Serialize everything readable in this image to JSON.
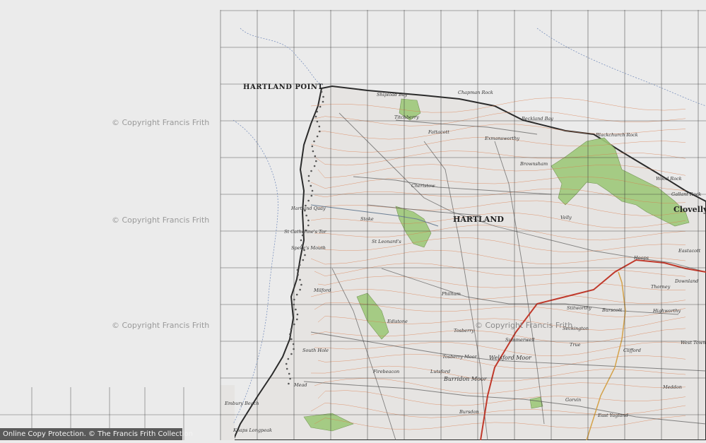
{
  "map": {
    "place_labels": {
      "hartland_point": "HARTLAND POINT",
      "hartland": "HARTLAND",
      "clovelly": "Clovelly",
      "welsford_moor": "Welsford Moor",
      "burridon_moor": "Burridon Moor",
      "embury_beach": "Embury Beach",
      "knaps_longpeak": "Knaps Longpeak",
      "chapman_rock": "Chapman Rock",
      "beckland_bay": "Beckland Bay",
      "shipload_bay": "Shipload Bay",
      "blackchurch_rock": "Blackchurch Rock",
      "wood_rock": "Wood Rock",
      "gallant_rock": "Gallant Rock",
      "hartland_quay": "Hartland Quay",
      "st_catherines_tor": "St Catherine's Tor",
      "speke_mouth": "Speke's Mouth",
      "stoke": "Stoke",
      "st_leonards": "St Leonard's",
      "edistone": "Edistone",
      "highworthy": "Highworthy",
      "thorney": "Thorney",
      "downland": "Downland",
      "eastacott": "Eastacott",
      "hoops": "Hoops",
      "true": "True",
      "milford": "Milford",
      "mead": "Mead",
      "titchberry": "Titchberry",
      "exmansworthy": "Exmansworthy",
      "brownsham": "Brownsham",
      "fattacott": "Fattacott",
      "lutsford": "Lutsford",
      "firebeacon": "Firebeacon",
      "summerwell": "Summerwell",
      "tosberry": "Tosberry",
      "tosberry_moor": "Tosberry Moor",
      "seckington": "Seckington",
      "stitworthy": "Stitworthy",
      "burscott": "Burscott",
      "clifford": "Clifford",
      "west_town": "West Town",
      "gorvin": "Gorvin",
      "east_yagland": "East Yagland",
      "philham": "Philham",
      "cheristow": "Cheristow",
      "south_hole": "South Hole",
      "velly": "Velly",
      "bursdon": "Bursdon",
      "meddon": "Meddon"
    },
    "watermarks": [
      "© Copyright Francis Frith",
      "© Copyright Francis Frith",
      "© Copyright Francis Frith",
      "© Copyright Francis Frith"
    ],
    "colors": {
      "sea": "#ebebeb",
      "land": "#e6e4e2",
      "woodland": "#9fc97a",
      "contour": "#d97a4a",
      "road_red": "#c0392b",
      "grid": "#333333",
      "coast": "#2b2b2b"
    }
  },
  "footer": {
    "copyright": "Online Copy Protection. © The Francis Frith Collection"
  }
}
